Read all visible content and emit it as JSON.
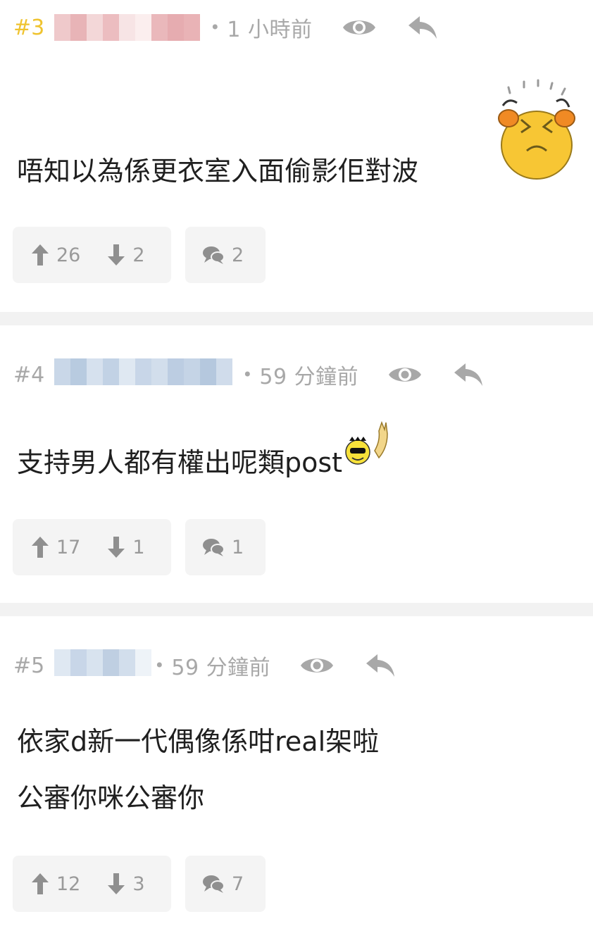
{
  "posts": [
    {
      "floor": "#3",
      "highlight": true,
      "time": "1 小時前",
      "lines": [
        "唔知以為係更衣室入面偷影佢對波"
      ],
      "sticker": "shocked-face-sticker",
      "upvotes": "26",
      "downvotes": "2",
      "replies": "2"
    },
    {
      "floor": "#4",
      "highlight": false,
      "time": "59 分鐘前",
      "lines": [
        "支持男人都有權出呢類post"
      ],
      "sticker": "sunglasses-smiley-sticker",
      "upvotes": "17",
      "downvotes": "1",
      "replies": "1"
    },
    {
      "floor": "#5",
      "highlight": false,
      "time": "59 分鐘前",
      "lines": [
        "依家d新一代偶像係咁real架啦",
        "公審你咪公審你"
      ],
      "upvotes": "12",
      "downvotes": "3",
      "replies": "7"
    }
  ],
  "colors": {
    "floor_highlight": "#efc32f",
    "meta_text": "#a8a8a8",
    "action_bg": "#f4f4f4",
    "username_blur_pink": "#e9b3b6",
    "username_blur_blue": "#bfcfe2"
  },
  "icons": [
    "eye-icon",
    "reply-icon",
    "thumb-up-arrow-icon",
    "thumb-down-arrow-icon",
    "comment-bubbles-icon"
  ]
}
